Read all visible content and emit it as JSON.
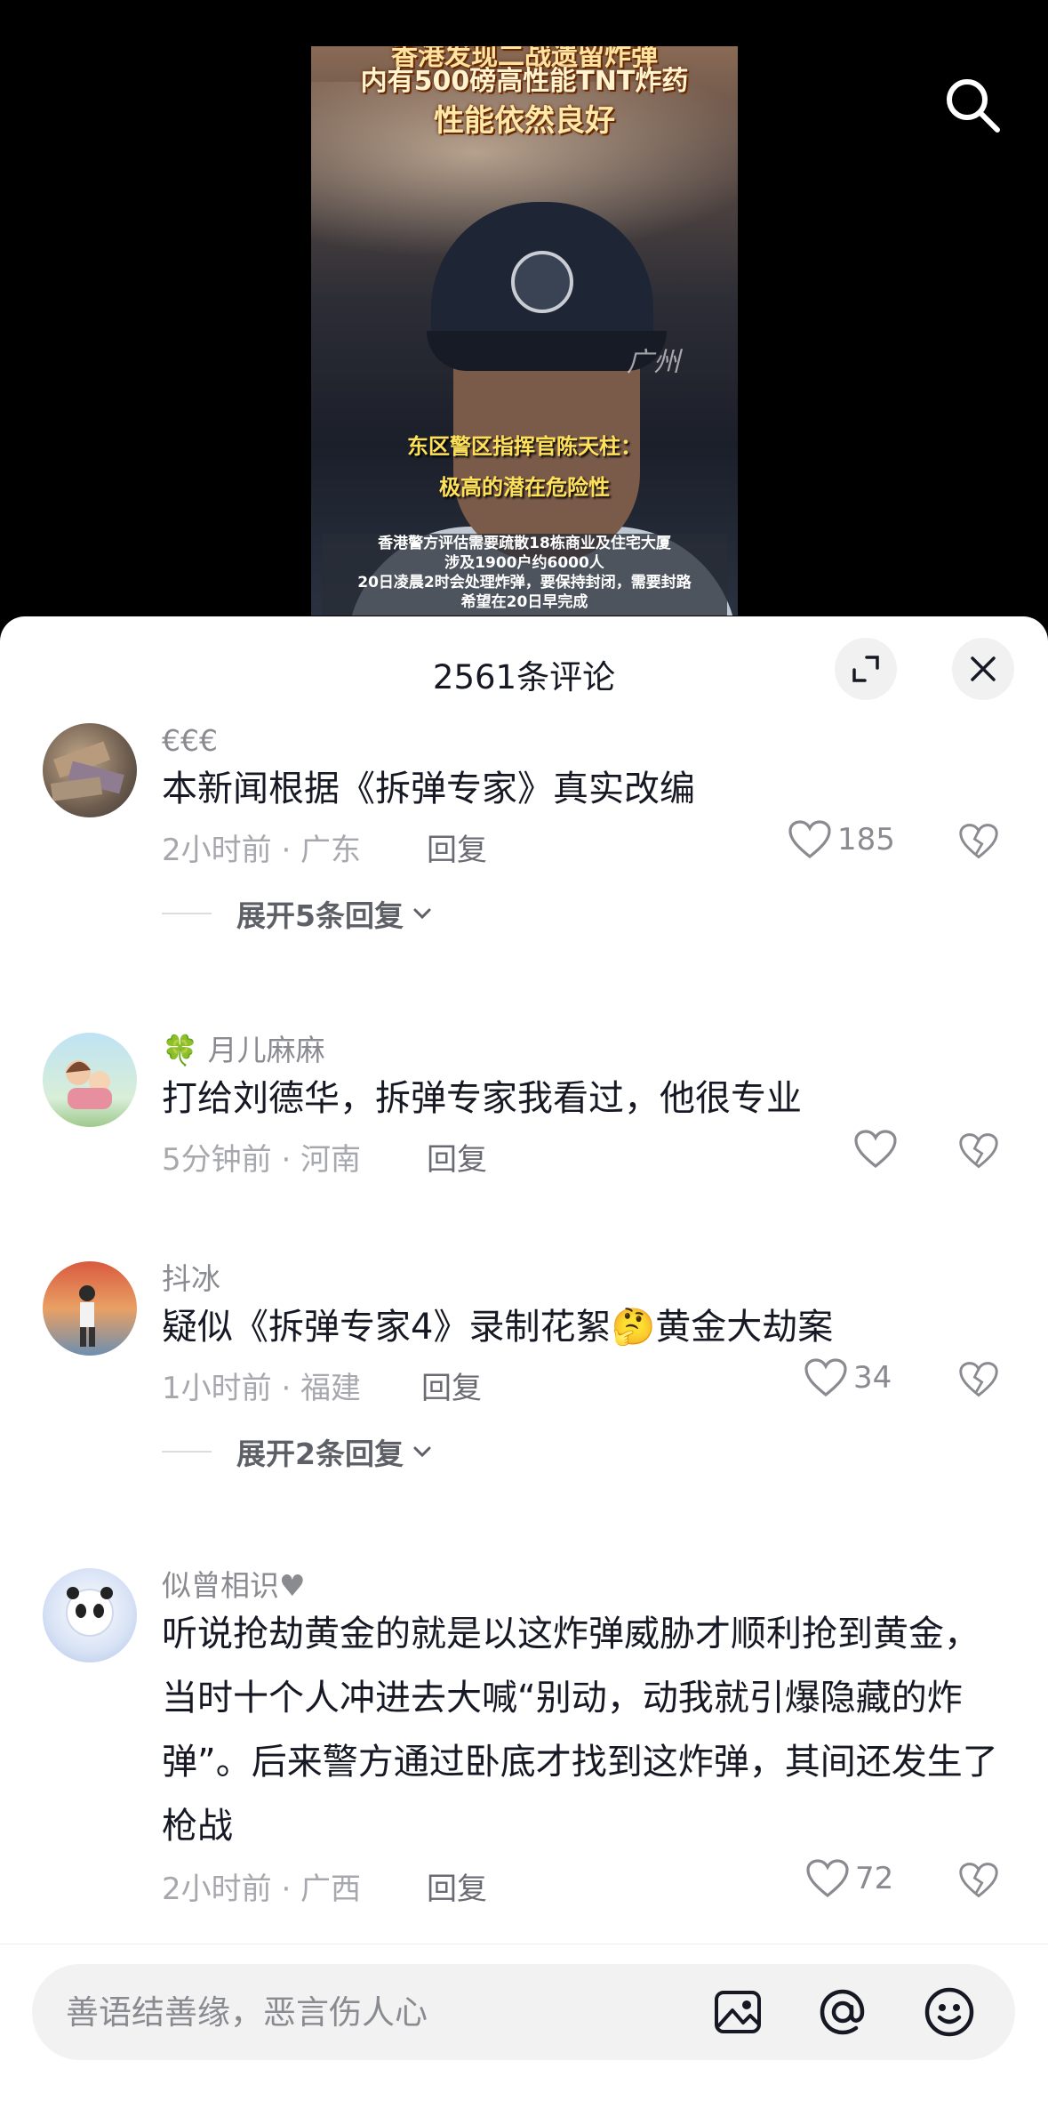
{
  "video": {
    "caption_top_cut": "香港发现二战遗留炸弹",
    "caption_line1": "内有500磅高性能TNT炸药",
    "caption_line2": "性能依然良好",
    "caption_mid1": "东区警区指挥官陈天柱：",
    "caption_mid2": "极高的潜在危险性",
    "caption_bottom": [
      "香港警方评估需要疏散18栋商业及住宅大厦",
      "涉及1900户约6000人",
      "20日凌晨2时会处理炸弹，要保持封闭，需要封路",
      "希望在20日早完成"
    ],
    "watermark": "广州"
  },
  "sheet": {
    "title": "2561条评论"
  },
  "comments": [
    {
      "username": "€€€",
      "text": "本新闻根据《拆弹专家》真实改编",
      "meta": "2小时前 · 广东",
      "reply_label": "回复",
      "likes": "185",
      "expand": "展开5条回复",
      "avatar_icon": "money-stack-avatar"
    },
    {
      "username": "🍀 月儿麻麻",
      "text": "打给刘德华，拆弹专家我看过，他很专业",
      "meta": "5分钟前 · 河南",
      "reply_label": "回复",
      "likes": "",
      "avatar_icon": "cartoon-family-avatar"
    },
    {
      "username": "抖冰",
      "text": "疑似《拆弹专家4》录制花絮🤔黄金大劫案",
      "meta": "1小时前 · 福建",
      "reply_label": "回复",
      "likes": "34",
      "expand": "展开2条回复",
      "avatar_icon": "dancer-avatar"
    },
    {
      "username": "似曾相识♥",
      "text": "听说抢劫黄金的就是以这炸弹威胁才顺利抢到黄金，当时十个人冲进去大喊“别动，动我就引爆隐藏的炸弹”。后来警方通过卧底才找到这炸弹，其间还发生了枪战",
      "meta": "2小时前 · 广西",
      "reply_label": "回复",
      "likes": "72",
      "avatar_icon": "panda-avatar"
    }
  ],
  "input": {
    "placeholder": "善语结善缘，恶言伤人心"
  },
  "colors": {
    "sheet_bg": "#ffffff",
    "text_primary": "#161823",
    "text_secondary": "#8a8b91"
  }
}
